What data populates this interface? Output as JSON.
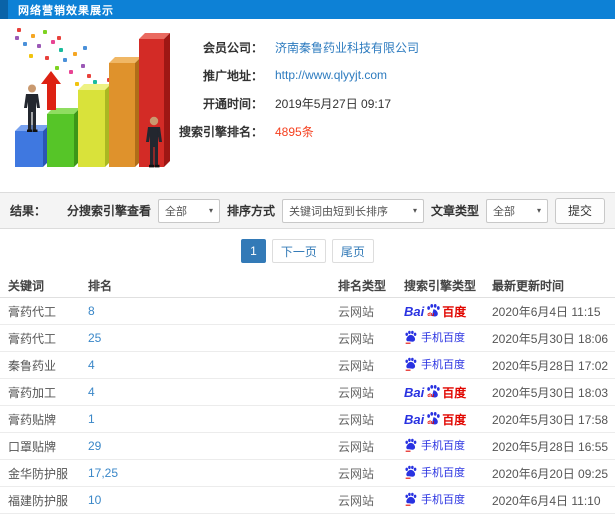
{
  "header": {
    "title": "网络营销效果展示"
  },
  "info": {
    "fields": [
      {
        "label": "会员公司：",
        "value": "济南秦鲁药业科技有限公司"
      },
      {
        "label": "推广地址：",
        "value": "http://www.qlyyjt.com"
      },
      {
        "label": "开通时间：",
        "value": "2019年5月27日 09:17"
      },
      {
        "label": "搜索引擎排名：",
        "value": "4895条"
      }
    ]
  },
  "filters": {
    "result_label": "结果：",
    "engine_label": "分搜索引擎查看",
    "engine_value": "全部",
    "sort_label": "排序方式",
    "sort_value": "关键词由短到长排序",
    "article_label": "文章类型",
    "article_value": "全部",
    "submit_label": "提交",
    "caret": "▾"
  },
  "pagination": {
    "current": "1",
    "next": "下一页",
    "last": "尾页"
  },
  "table": {
    "headers": [
      "关键词",
      "排名",
      "排名类型",
      "搜索引擎类型",
      "最新更新时间"
    ],
    "engine_labels": {
      "baidu_pc": {
        "bai": "Bai",
        "du": "du",
        "cn": "百度"
      },
      "baidu_mobile": "手机百度"
    },
    "rows": [
      {
        "keyword": "膏药代工",
        "rank": "8",
        "rank_type": "云网站",
        "engine": "baidu-pc",
        "updated": "2020年6月4日 11:15"
      },
      {
        "keyword": "膏药代工",
        "rank": "25",
        "rank_type": "云网站",
        "engine": "baidu-mobile",
        "updated": "2020年5月30日 18:06"
      },
      {
        "keyword": "秦鲁药业",
        "rank": "4",
        "rank_type": "云网站",
        "engine": "baidu-mobile",
        "updated": "2020年5月28日 17:02"
      },
      {
        "keyword": "膏药加工",
        "rank": "4",
        "rank_type": "云网站",
        "engine": "baidu-pc",
        "updated": "2020年5月30日 18:03"
      },
      {
        "keyword": "膏药贴牌",
        "rank": "1",
        "rank_type": "云网站",
        "engine": "baidu-pc",
        "updated": "2020年5月30日 17:58"
      },
      {
        "keyword": "口罩贴牌",
        "rank": "29",
        "rank_type": "云网站",
        "engine": "baidu-mobile",
        "updated": "2020年5月28日 16:55"
      },
      {
        "keyword": "金华防护服",
        "rank": "17,25",
        "rank_type": "云网站",
        "engine": "baidu-mobile",
        "updated": "2020年6月20日 09:25"
      },
      {
        "keyword": "福建防护服",
        "rank": "10",
        "rank_type": "云网站",
        "engine": "baidu-mobile",
        "updated": "2020年6月4日 11:10"
      }
    ]
  },
  "colors": {
    "header_blue": "#0d81d6",
    "header_accent": "#0a63a8",
    "link_blue": "#2d7bbf",
    "count_red": "#f5401f",
    "baidu_blue": "#2932e1",
    "baidu_red": "#e10600",
    "pagination_active": "#337ab7"
  }
}
